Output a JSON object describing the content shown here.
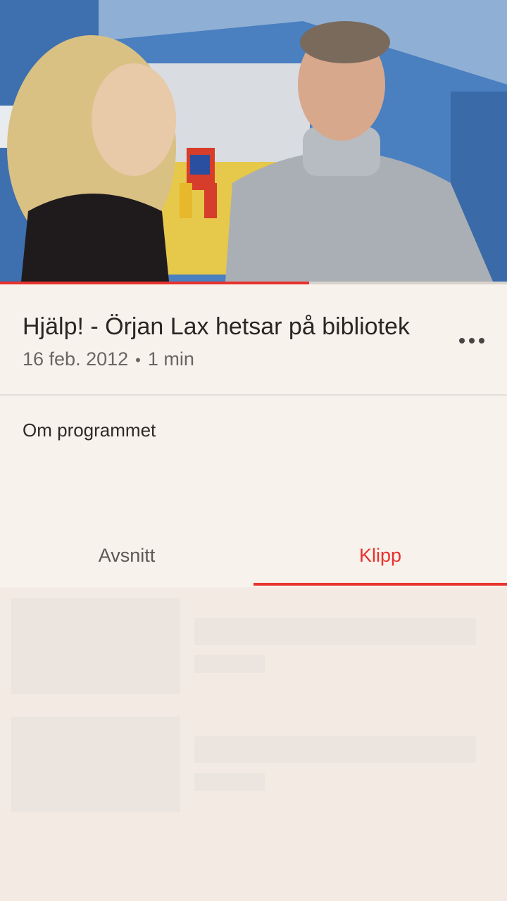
{
  "video": {
    "progress_fraction": 0.61,
    "accent_color": "#e8322e"
  },
  "program": {
    "title": "Hjälp! - Örjan Lax hetsar på bibliotek",
    "date": "16 feb. 2012",
    "separator": "•",
    "duration": "1 min",
    "more_icon": "more-horizontal-icon"
  },
  "about": {
    "label": "Om programmet"
  },
  "tabs": [
    {
      "label": "Avsnitt",
      "selected": false
    },
    {
      "label": "Klipp",
      "selected": true
    }
  ],
  "list": {
    "state": "loading",
    "placeholder_count": 2
  }
}
